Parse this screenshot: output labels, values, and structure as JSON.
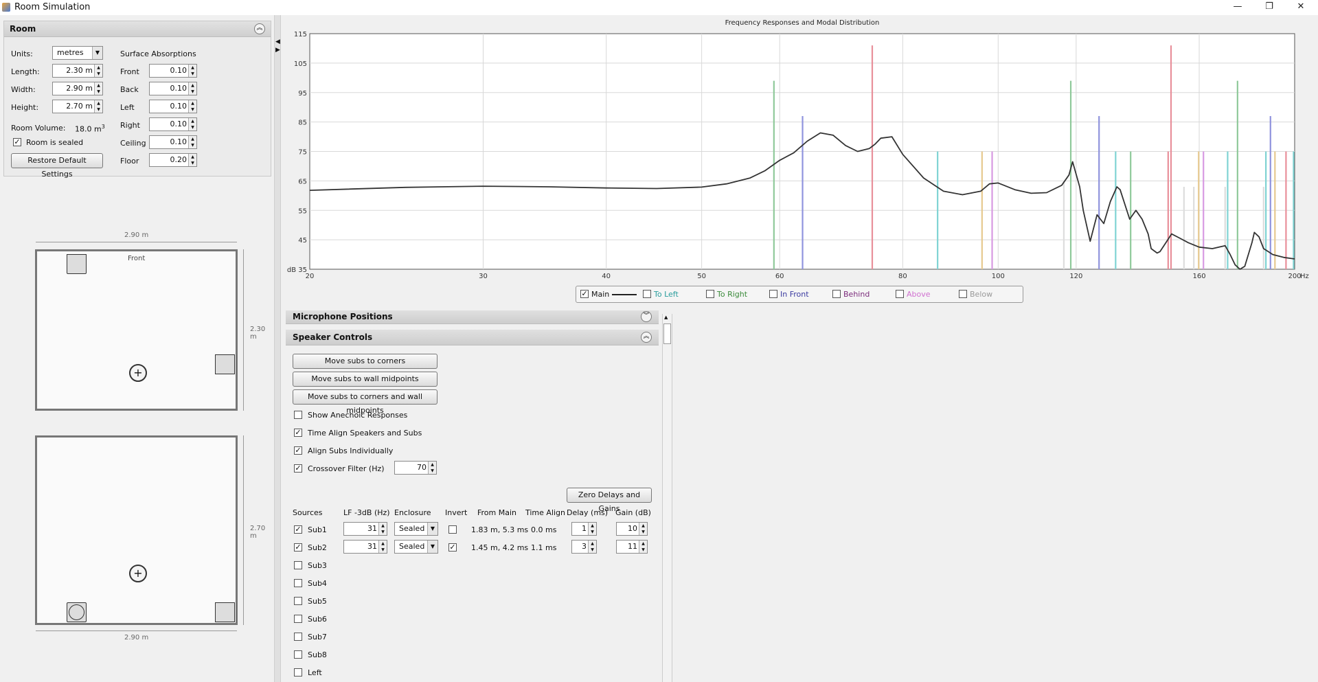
{
  "window": {
    "title": "Room Simulation",
    "minimize": "—",
    "maximize": "❐",
    "close": "✕"
  },
  "room": {
    "header": "Room",
    "units_label": "Units:",
    "units_value": "metres",
    "length_label": "Length:",
    "length_value": "2.30 m",
    "width_label": "Width:",
    "width_value": "2.90 m",
    "height_label": "Height:",
    "height_value": "2.70 m",
    "volume_label": "Room Volume:",
    "volume_value": "18.0 m",
    "volume_unit_sup": "3",
    "sealed_label": "Room is sealed",
    "sealed_checked": "✓",
    "restore_button": "Restore Default Settings",
    "absorptions_title": "Surface Absorptions",
    "surfaces": [
      {
        "label": "Front",
        "value": "0.10"
      },
      {
        "label": "Back",
        "value": "0.10"
      },
      {
        "label": "Left",
        "value": "0.10"
      },
      {
        "label": "Right",
        "value": "0.10"
      },
      {
        "label": "Ceiling",
        "value": "0.10"
      },
      {
        "label": "Floor",
        "value": "0.20"
      }
    ]
  },
  "plan_view": {
    "width_dim": "2.90 m",
    "depth_dim": "2.30 m",
    "front_label": "Front"
  },
  "side_view": {
    "width_dim": "2.90 m",
    "height_dim": "2.70 m"
  },
  "chart_data": {
    "type": "line",
    "title": "Frequency Responses and Modal Distribution",
    "xscale": "log",
    "xlim": [
      20,
      200
    ],
    "ylim": [
      35,
      115
    ],
    "x_ticks": [
      {
        "v": 20,
        "label": "20"
      },
      {
        "v": 30,
        "label": "30"
      },
      {
        "v": 40,
        "label": "40"
      },
      {
        "v": 50,
        "label": "50"
      },
      {
        "v": 60,
        "label": "60"
      },
      {
        "v": 80,
        "label": "80"
      },
      {
        "v": 100,
        "label": "100"
      },
      {
        "v": 120,
        "label": "120"
      },
      {
        "v": 160,
        "label": "160"
      },
      {
        "v": 200,
        "label": "200"
      }
    ],
    "x_unit": "Hz",
    "y_ticks": [
      {
        "v": 35,
        "label": "dB 35"
      },
      {
        "v": 45,
        "label": "45"
      },
      {
        "v": 55,
        "label": "55"
      },
      {
        "v": 65,
        "label": "65"
      },
      {
        "v": 75,
        "label": "75"
      },
      {
        "v": 85,
        "label": "85"
      },
      {
        "v": 95,
        "label": "95"
      },
      {
        "v": 105,
        "label": "105"
      },
      {
        "v": 115,
        "label": "115"
      }
    ],
    "grid": true,
    "series": [
      {
        "name": "Main",
        "color": "#333333",
        "x": [
          20,
          25,
          30,
          35,
          40,
          45,
          50,
          53,
          56,
          58,
          60,
          62,
          64,
          66,
          68,
          70,
          72,
          74,
          75,
          76,
          78,
          80,
          84,
          88,
          92,
          96,
          98,
          100,
          104,
          108,
          112,
          116,
          118,
          119,
          121,
          122,
          124,
          125,
          126,
          128,
          130,
          132,
          133,
          136,
          138,
          140,
          142,
          143,
          145,
          146,
          148,
          150,
          153,
          156,
          160,
          165,
          170,
          172,
          174,
          176,
          178,
          181,
          182,
          184,
          186,
          188,
          190,
          195,
          200
        ],
        "y": [
          61.8,
          62.8,
          63.2,
          63.0,
          62.6,
          62.4,
          62.9,
          64.0,
          66.0,
          68.5,
          72.0,
          74.5,
          78.5,
          81.3,
          80.5,
          77.0,
          75.0,
          76.0,
          77.5,
          79.5,
          80.0,
          74.0,
          66.0,
          61.5,
          60.3,
          61.5,
          64.0,
          64.3,
          62.0,
          60.8,
          61.0,
          63.5,
          67.0,
          71.5,
          63.0,
          55.0,
          44.5,
          49.0,
          53.5,
          50.5,
          58.0,
          63.0,
          62.0,
          52.0,
          55.0,
          52.0,
          47.0,
          42.0,
          40.5,
          41.0,
          44.0,
          47.0,
          45.5,
          44.0,
          42.5,
          42.0,
          43.0,
          40.0,
          36.5,
          33.0,
          36.0,
          44.0,
          47.5,
          46.0,
          42.0,
          41.0,
          40.0,
          39.0,
          38.5
        ]
      }
    ],
    "modes": [
      {
        "f": 59.2,
        "h": 99,
        "c": "#8fc99a"
      },
      {
        "f": 63.3,
        "h": 87,
        "c": "#8f93dd"
      },
      {
        "f": 74.5,
        "h": 111,
        "c": "#e88f9a"
      },
      {
        "f": 86.8,
        "h": 75,
        "c": "#7fd3d3"
      },
      {
        "f": 96.3,
        "h": 75,
        "c": "#e6c98f"
      },
      {
        "f": 98.6,
        "h": 75,
        "c": "#d79ae2"
      },
      {
        "f": 116.6,
        "h": 65,
        "c": "#dddddd"
      },
      {
        "f": 118.5,
        "h": 99,
        "c": "#8fc99a"
      },
      {
        "f": 126.6,
        "h": 87,
        "c": "#8f93dd"
      },
      {
        "f": 131.6,
        "h": 75,
        "c": "#7fd3d3"
      },
      {
        "f": 136.3,
        "h": 75,
        "c": "#8fc99a"
      },
      {
        "f": 148.8,
        "h": 75,
        "c": "#e88f9a"
      },
      {
        "f": 149.8,
        "h": 111,
        "c": "#e88f9a"
      },
      {
        "f": 154.4,
        "h": 63,
        "c": "#dddddd"
      },
      {
        "f": 158.0,
        "h": 63,
        "c": "#dddddd"
      },
      {
        "f": 159.8,
        "h": 75,
        "c": "#e6c98f"
      },
      {
        "f": 161.6,
        "h": 75,
        "c": "#d79ae2"
      },
      {
        "f": 170.0,
        "h": 63,
        "c": "#dddddd"
      },
      {
        "f": 171.0,
        "h": 75,
        "c": "#7fd3d3"
      },
      {
        "f": 175.0,
        "h": 99,
        "c": "#8fc99a"
      },
      {
        "f": 186.0,
        "h": 63,
        "c": "#dddddd"
      },
      {
        "f": 187.0,
        "h": 75,
        "c": "#7fd3d3"
      },
      {
        "f": 189.0,
        "h": 87,
        "c": "#8f93dd"
      },
      {
        "f": 191.0,
        "h": 75,
        "c": "#e6c98f"
      },
      {
        "f": 196.0,
        "h": 75,
        "c": "#e88f9a"
      },
      {
        "f": 199.5,
        "h": 75,
        "c": "#7fd3d3"
      }
    ]
  },
  "legend": {
    "items": [
      {
        "label": "Main",
        "checked": "✓",
        "color": "#222222"
      },
      {
        "label": "To Left",
        "checked": "",
        "color": "#2a9d9d"
      },
      {
        "label": "To Right",
        "checked": "",
        "color": "#3a8a3a"
      },
      {
        "label": "In Front",
        "checked": "",
        "color": "#3a3aa0"
      },
      {
        "label": "Behind",
        "checked": "",
        "color": "#7a2a7a"
      },
      {
        "label": "Above",
        "checked": "",
        "color": "#d070d0"
      },
      {
        "label": "Below",
        "checked": "",
        "color": "#999999"
      }
    ]
  },
  "mic_section": {
    "header": "Microphone Positions"
  },
  "speaker_section": {
    "header": "Speaker Controls",
    "btn_corners": "Move subs to corners",
    "btn_midpoints": "Move subs to wall midpoints",
    "btn_both": "Move subs to corners and wall midpoints",
    "show_anechoic": "Show Anechoic Responses",
    "show_anechoic_checked": "",
    "time_align": "Time Align Speakers and Subs",
    "time_align_checked": "✓",
    "align_subs": "Align Subs Individually",
    "align_subs_checked": "✓",
    "crossover": "Crossover Filter (Hz)",
    "crossover_checked": "✓",
    "crossover_value": "70",
    "zero_button": "Zero Delays and Gains",
    "columns": [
      "Sources",
      "LF -3dB (Hz)",
      "Enclosure",
      "Invert",
      "From Main",
      "Time Align",
      "Delay (ms)",
      "Gain (dB)"
    ],
    "active_rows": [
      {
        "name": "Sub1",
        "checked": "✓",
        "lf": "31",
        "enclosure": "Sealed",
        "invert": "",
        "from_main": "1.83 m, 5.3 ms",
        "time_align": "0.0 ms",
        "delay": "1",
        "gain": "10"
      },
      {
        "name": "Sub2",
        "checked": "✓",
        "lf": "31",
        "enclosure": "Sealed",
        "invert": "✓",
        "from_main": "1.45 m, 4.2 ms",
        "time_align": "1.1 ms",
        "delay": "3",
        "gain": "11"
      }
    ],
    "inactive_rows": [
      "Sub3",
      "Sub4",
      "Sub5",
      "Sub6",
      "Sub7",
      "Sub8",
      "Left"
    ]
  }
}
